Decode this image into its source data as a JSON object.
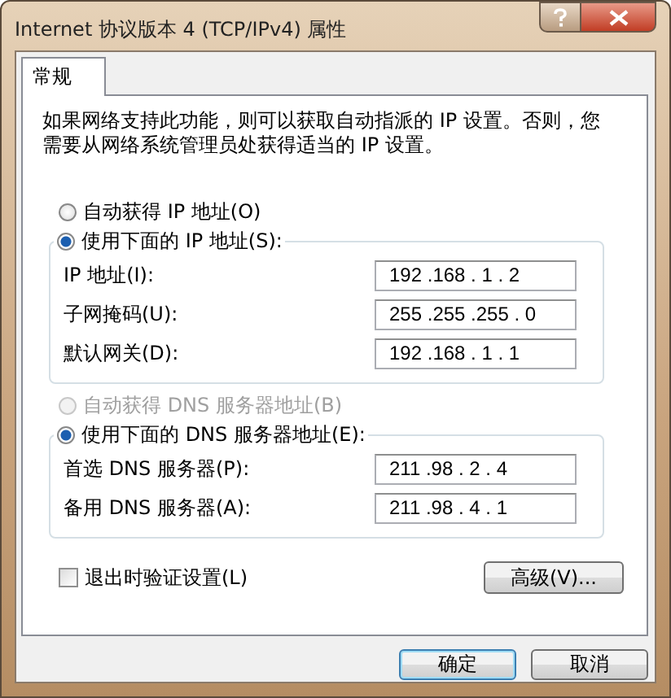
{
  "window": {
    "title": "Internet 协议版本 4 (TCP/IPv4) 属性"
  },
  "tabs": [
    {
      "label": "常规",
      "selected": true
    }
  ],
  "description": "如果网络支持此功能，则可以获取自动指派的 IP 设置。否则，您需要从网络系统管理员处获得适当的 IP 设置。",
  "sections": [
    {
      "options": [
        {
          "label": "自动获得 IP 地址(O)",
          "selected": false,
          "disabled": false
        },
        {
          "label": "使用下面的 IP 地址(S):",
          "selected": true,
          "disabled": false
        }
      ],
      "fields": [
        {
          "label": "IP 地址(I):",
          "value": "192 .168 . 1 . 2"
        },
        {
          "label": "子网掩码(U):",
          "value": "255 .255 .255 . 0"
        },
        {
          "label": "默认网关(D):",
          "value": "192 .168 . 1 . 1"
        }
      ]
    },
    {
      "options": [
        {
          "label": "自动获得 DNS 服务器地址(B)",
          "selected": false,
          "disabled": true
        },
        {
          "label": "使用下面的 DNS 服务器地址(E):",
          "selected": true,
          "disabled": false
        }
      ],
      "fields": [
        {
          "label": "首选 DNS 服务器(P):",
          "value": "211 .98 . 2 . 4"
        },
        {
          "label": "备用 DNS 服务器(A):",
          "value": "211 .98 . 4 . 1"
        }
      ]
    }
  ],
  "validate_checkbox": {
    "label": "退出时验证设置(L)",
    "checked": false
  },
  "advanced_button": "高级(V)...",
  "buttons": [
    {
      "label": "确定",
      "default": true
    },
    {
      "label": "取消",
      "default": false
    }
  ]
}
